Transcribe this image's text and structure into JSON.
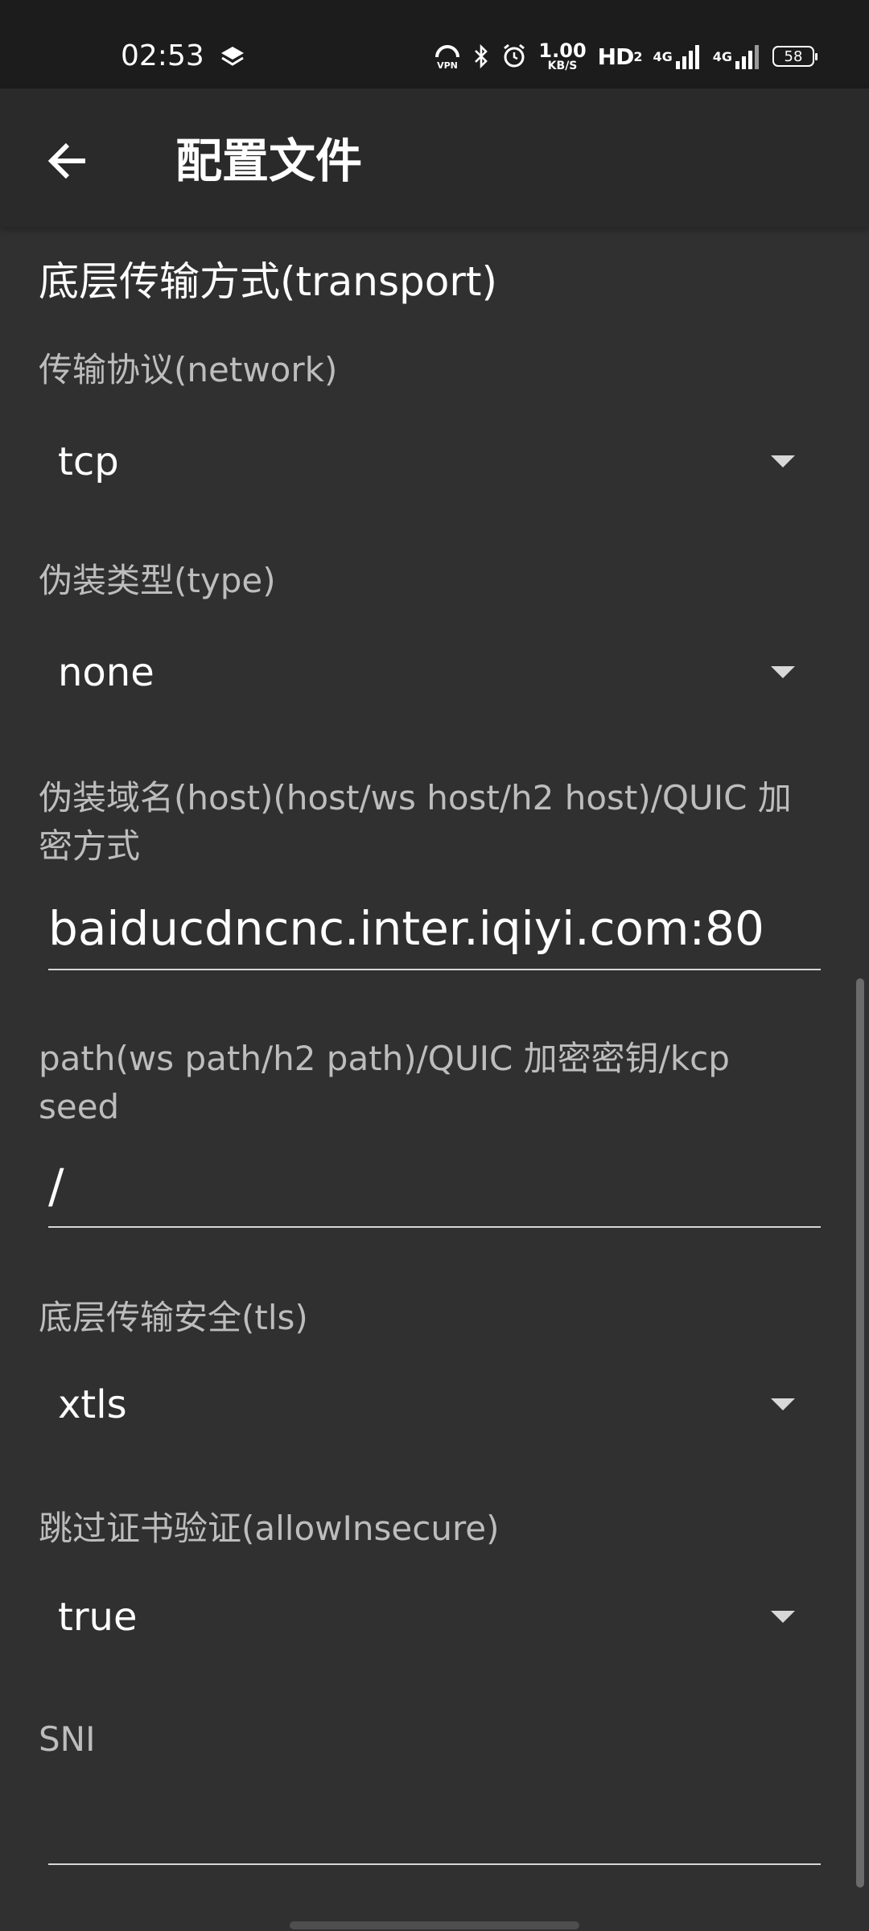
{
  "status_bar": {
    "time": "02:53",
    "speed_value": "1.00",
    "speed_unit": "KB/S",
    "hd_label": "HD",
    "hd_sub": "2",
    "net1": "4G",
    "net2": "4G",
    "battery": "58",
    "icons": [
      "layers-icon",
      "vpn-icon",
      "bluetooth-icon",
      "alarm-icon",
      "signal-icon",
      "signal-icon"
    ]
  },
  "app_bar": {
    "title": "配置文件",
    "back_icon": "arrow-left-icon"
  },
  "transport": {
    "section_title": "底层传输方式(transport)",
    "network_label": "传输协议(network)",
    "network_value": "tcp",
    "type_label": "伪装类型(type)",
    "type_value": "none",
    "host_label": "伪装域名(host)(host/ws host/h2 host)/QUIC 加密方式",
    "host_value": "baiducdncnc.inter.iqiyi.com:80",
    "path_label": "path(ws path/h2 path)/QUIC 加密密钥/kcp seed",
    "path_value": "/",
    "tls_label": "底层传输安全(tls)",
    "tls_value": "xtls",
    "insecure_label": "跳过证书验证(allowInsecure)",
    "insecure_value": "true",
    "sni_label": "SNI",
    "sni_value": ""
  },
  "colors": {
    "background": "#303030",
    "app_bar": "#2a2a2a",
    "status_bar": "#1c1c1c",
    "label": "#bdbdbd",
    "text": "#ffffff"
  }
}
